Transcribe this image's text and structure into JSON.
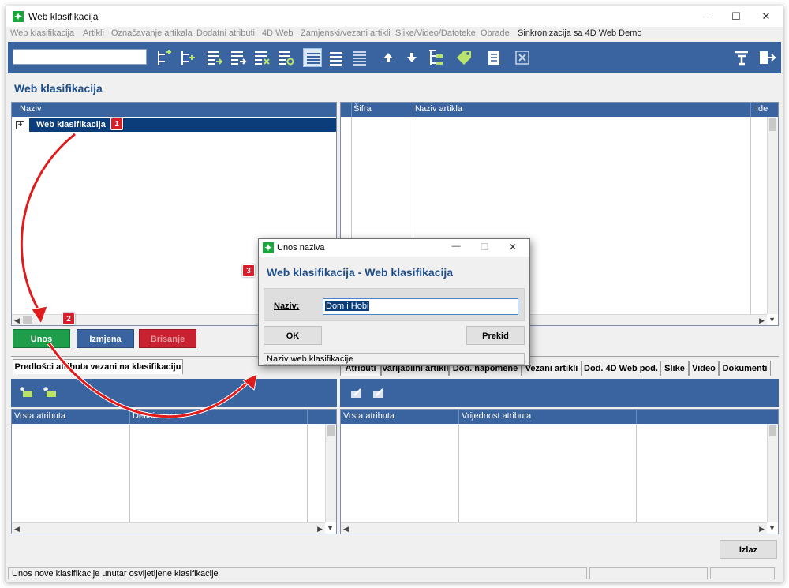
{
  "window": {
    "title": "Web klasifikacija",
    "controls": {
      "minimize": "—",
      "maximize": "☐",
      "close": "✕"
    }
  },
  "menu": {
    "items": [
      "Web klasifikacija",
      "Artikli",
      "Označavanje artikala",
      "Dodatni atributi",
      "4D Web",
      "Zamjenski/vezani artikli",
      "Slike/Video/Datoteke",
      "Obrade",
      "Sinkronizacija sa 4D Web Demo"
    ]
  },
  "toolbar": {
    "search_value": "",
    "icons": [
      "add-child-node-icon",
      "add-sibling-node-icon",
      "list-export-icon",
      "list-move-icon",
      "list-delete-icon",
      "list-refresh-icon",
      "view-list-selected-icon",
      "view-list-icon",
      "view-list-compact-icon",
      "arrow-up-icon",
      "arrow-down-icon",
      "tree-icon",
      "tag-icon",
      "document-icon",
      "close-box-icon",
      "filter-icon",
      "exit-icon"
    ]
  },
  "page_title": "Web klasifikacija",
  "tree_panel": {
    "header": "Naziv",
    "root_expander": "+",
    "root_label": "Web klasifikacija"
  },
  "articles_panel": {
    "columns": [
      "Šifra",
      "Naziv artikla",
      "Ide"
    ]
  },
  "buttons": {
    "unos": "Unos",
    "izmjena": "Izmjena",
    "brisanje": "Brisanje",
    "izlaz": "Izlaz"
  },
  "left_tabs": [
    "Predlošci atributa vezani na klasifikaciju"
  ],
  "right_tabs": [
    "Atributi",
    "Varijabilni artikli",
    "Dod. napomene",
    "Vezani artikli",
    "Dod. 4D Web pod.",
    "Slike",
    "Video",
    "Dokumenti"
  ],
  "left_attr_panel": {
    "columns": [
      "Vrsta atributa",
      "Definirano na"
    ]
  },
  "right_attr_panel": {
    "columns": [
      "Vrsta atributa",
      "Vrijednost atributa"
    ]
  },
  "dialog": {
    "title": "Unos naziva",
    "heading": "Web klasifikacija - Web klasifikacija",
    "field_label": "Naziv:",
    "field_value": "Dom i Hobi",
    "ok": "OK",
    "cancel": "Prekid",
    "status": "Naziv web klasifikacije",
    "controls": {
      "minimize": "—",
      "maximize": "☐",
      "close": "✕"
    }
  },
  "status_bar": {
    "message": "Unos nove klasifikacije unutar osvijetljene klasifikacije"
  },
  "markers": [
    "1",
    "2",
    "3"
  ],
  "colors": {
    "accent_blue": "#3a64a0",
    "title_blue": "#1f4f8b",
    "selection_navy": "#0a3d7a",
    "green_button": "#1e9e4a",
    "red_button": "#c8212f",
    "marker_red": "#d51f2a",
    "arrow_red": "#e01b1b"
  }
}
